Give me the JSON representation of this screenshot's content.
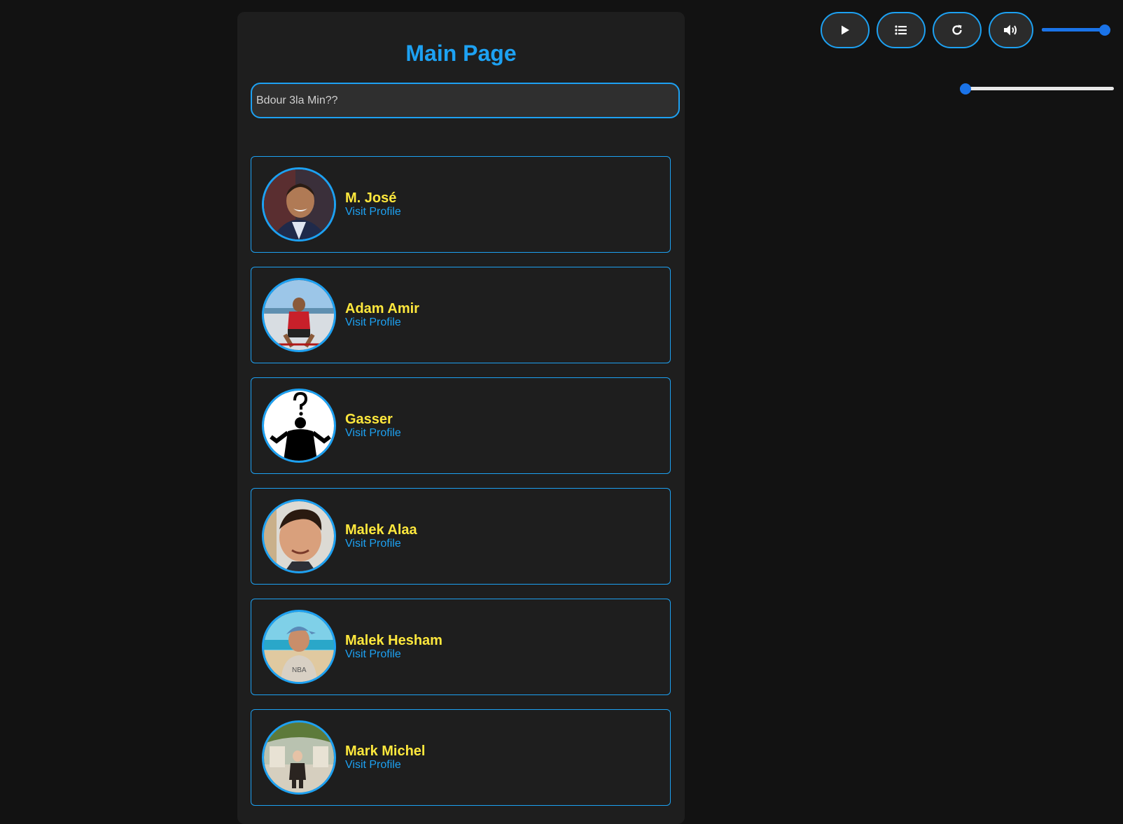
{
  "title": "Main Page",
  "search": {
    "placeholder": "Bdour 3la Min??",
    "value": ""
  },
  "controls": {
    "play_icon": "play-icon",
    "playlist_icon": "list-icon",
    "repeat_icon": "refresh-icon",
    "volume_icon": "volume-icon",
    "volume_level": 1.0,
    "seek_position": 0.0
  },
  "profiles": [
    {
      "name": "M. José",
      "link": "Visit Profile"
    },
    {
      "name": "Adam Amir",
      "link": "Visit Profile"
    },
    {
      "name": "Gasser",
      "link": "Visit Profile"
    },
    {
      "name": "Malek Alaa",
      "link": "Visit Profile"
    },
    {
      "name": "Malek Hesham",
      "link": "Visit Profile"
    },
    {
      "name": "Mark Michel",
      "link": "Visit Profile"
    }
  ],
  "colors": {
    "accent": "#1da1f2",
    "name": "#ffe83d",
    "slider": "#1a73e8",
    "background": "#121212",
    "panel": "#1e1e1e"
  }
}
